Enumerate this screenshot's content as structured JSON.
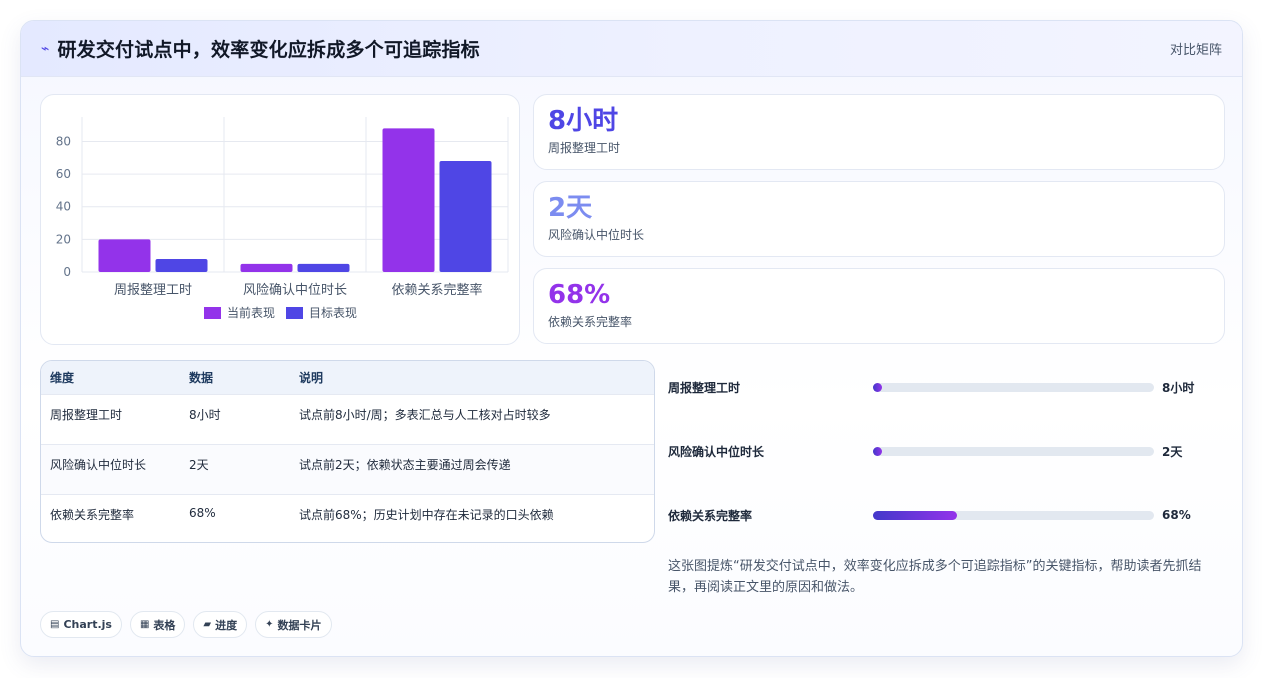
{
  "header": {
    "icon": "trend-icon",
    "title": "研发交付试点中，效率变化应拆成多个可追踪指标",
    "right_label": "对比矩阵"
  },
  "chart_data": {
    "type": "bar",
    "categories": [
      "周报整理工时",
      "风险确认中位时长",
      "依赖关系完整率"
    ],
    "series": [
      {
        "name": "当前表现",
        "values": [
          20,
          5,
          88
        ],
        "color": "#9333ea"
      },
      {
        "name": "目标表现",
        "values": [
          8,
          5,
          68
        ],
        "color": "#4f46e5"
      }
    ],
    "yticks": [
      "0",
      "20",
      "40",
      "60",
      "80"
    ],
    "ylim": [
      0,
      95
    ],
    "grid": true,
    "legend": "bottom"
  },
  "kpis": [
    {
      "value": "8小时",
      "label": "周报整理工时",
      "color": "#4f46e5"
    },
    {
      "value": "2天",
      "label": "风险确认中位时长",
      "color": "#7c8cf0"
    },
    {
      "value": "68%",
      "label": "依赖关系完整率",
      "color": "#9333ea"
    }
  ],
  "table": {
    "headers": [
      "维度",
      "数据",
      "说明"
    ],
    "rows": [
      [
        "周报整理工时",
        "8小时",
        "试点前8小时/周；多表汇总与人工核对占时较多"
      ],
      [
        "风险确认中位时长",
        "2天",
        "试点前2天；依赖状态主要通过周会传递"
      ],
      [
        "依赖关系完整率",
        "68%",
        "试点前68%；历史计划中存在未记录的口头依赖"
      ]
    ]
  },
  "progress": [
    {
      "label": "周报整理工时",
      "value": "8小时",
      "fraction": 0.0
    },
    {
      "label": "风险确认中位时长",
      "value": "2天",
      "fraction": 0.0
    },
    {
      "label": "依赖关系完整率",
      "value": "68%",
      "fraction": 0.3
    }
  ],
  "summary": "这张图提炼“研发交付试点中，效率变化应拆成多个可追踪指标”的关键指标，帮助读者先抓结果，再阅读正文里的原因和做法。",
  "chips": [
    {
      "icon": "▤",
      "label": "Chart.js"
    },
    {
      "icon": "▦",
      "label": "表格"
    },
    {
      "icon": "▰",
      "label": "进度"
    },
    {
      "icon": "✦",
      "label": "数据卡片"
    }
  ]
}
